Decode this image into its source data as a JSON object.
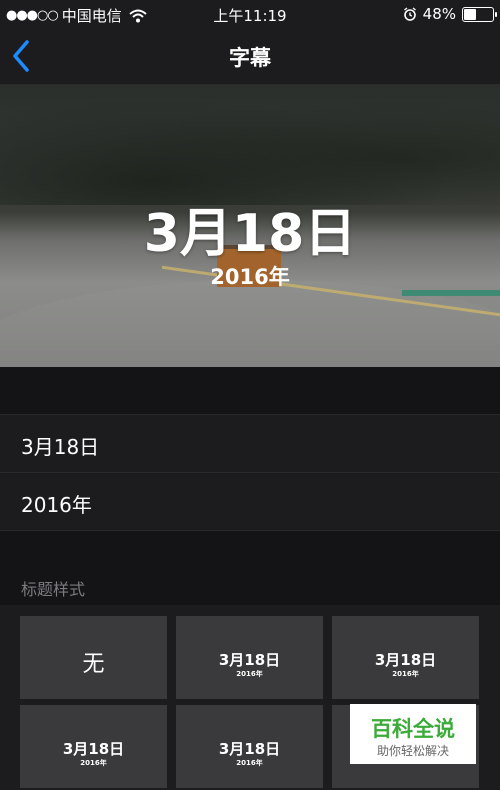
{
  "status_bar": {
    "carrier": "中国电信",
    "time": "上午11:19",
    "battery_percent": "48%",
    "battery_level": 0.48,
    "signal_icon": "signal-dots-icon",
    "wifi_icon": "wifi-icon",
    "alarm_icon": "alarm-clock-icon"
  },
  "nav": {
    "title": "字幕",
    "back_icon": "chevron-left-icon"
  },
  "preview": {
    "date": "3月18日",
    "year": "2016年"
  },
  "fields": {
    "title_value": "3月18日",
    "subtitle_value": "2016年"
  },
  "section": {
    "label": "标题样式"
  },
  "style_tiles": [
    {
      "label": "无"
    },
    {
      "date": "3月18日",
      "year": "2016年"
    },
    {
      "date": "3月18日",
      "year": "2016年"
    },
    {
      "date": "3月18日",
      "year": "2016年"
    },
    {
      "date": "3月18日",
      "year": "2016年"
    }
  ],
  "watermark": {
    "title": "百科全说",
    "subtitle": "助你轻松解决"
  },
  "colors": {
    "accent": "#1a8cff",
    "background": "#141416",
    "tile": "#3a3a3c",
    "watermark_green": "#3cab3a"
  }
}
